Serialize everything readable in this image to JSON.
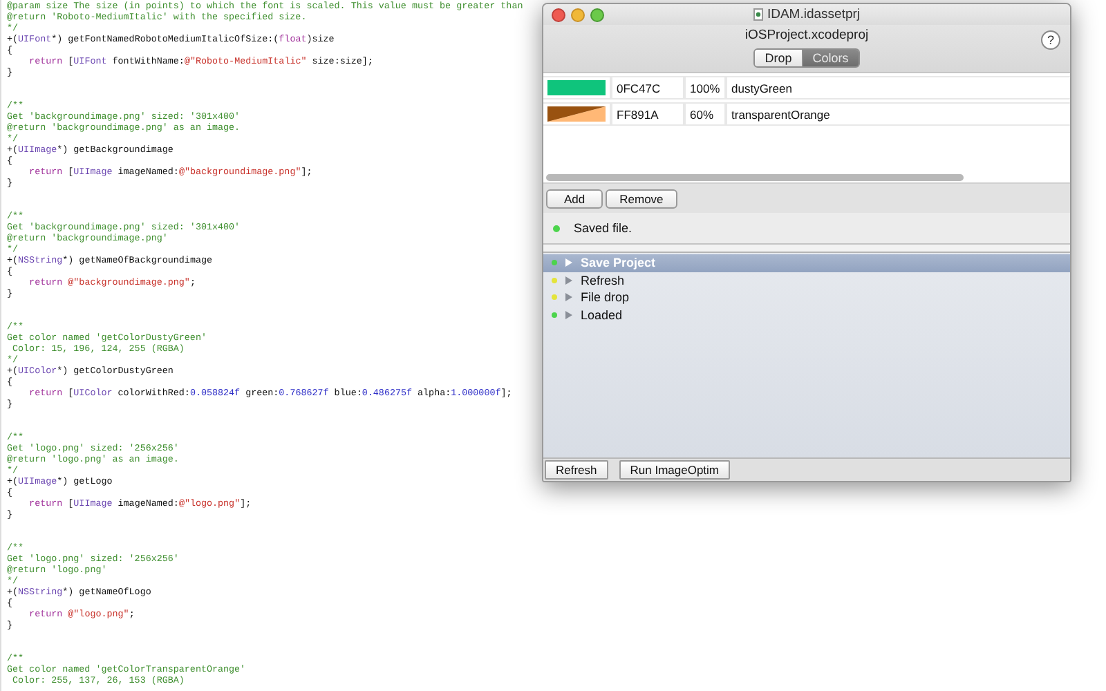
{
  "editor": {
    "blocks": [
      {
        "lines": [
          [
            {
              "kind": "comment",
              "text": "@param size The size (in points) to which the font is scaled. This value must be greater than"
            }
          ],
          [
            {
              "kind": "comment",
              "text": "@return 'Roboto-MediumItalic' with the specified size."
            }
          ],
          [
            {
              "kind": "comment",
              "text": "*/"
            }
          ],
          [
            {
              "kind": "plain",
              "text": "+("
            },
            {
              "kind": "type",
              "text": "UIFont"
            },
            {
              "kind": "plain",
              "text": "*) getFontNamedRobotoMediumItalicOfSize:("
            },
            {
              "kind": "keyword",
              "text": "float"
            },
            {
              "kind": "plain",
              "text": ")size"
            }
          ],
          [
            {
              "kind": "plain",
              "text": "{"
            }
          ],
          [
            {
              "kind": "keyword",
              "text": "    return"
            },
            {
              "kind": "plain",
              "text": " ["
            },
            {
              "kind": "type",
              "text": "UIFont"
            },
            {
              "kind": "plain",
              "text": " fontWithName:"
            },
            {
              "kind": "string",
              "text": "@\"Roboto-MediumItalic\""
            },
            {
              "kind": "plain",
              "text": " size:size];"
            }
          ],
          [
            {
              "kind": "plain",
              "text": "}"
            }
          ]
        ]
      },
      {
        "lines": [
          [
            {
              "kind": "comment",
              "text": "/**"
            }
          ],
          [
            {
              "kind": "comment",
              "text": "Get 'backgroundimage.png' sized: '301x400'"
            }
          ],
          [
            {
              "kind": "comment",
              "text": "@return 'backgroundimage.png' as an image."
            }
          ],
          [
            {
              "kind": "comment",
              "text": "*/"
            }
          ],
          [
            {
              "kind": "plain",
              "text": "+("
            },
            {
              "kind": "type",
              "text": "UIImage"
            },
            {
              "kind": "plain",
              "text": "*) getBackgroundimage"
            }
          ],
          [
            {
              "kind": "plain",
              "text": "{"
            }
          ],
          [
            {
              "kind": "keyword",
              "text": "    return"
            },
            {
              "kind": "plain",
              "text": " ["
            },
            {
              "kind": "type",
              "text": "UIImage"
            },
            {
              "kind": "plain",
              "text": " imageNamed:"
            },
            {
              "kind": "string",
              "text": "@\"backgroundimage.png\""
            },
            {
              "kind": "plain",
              "text": "];"
            }
          ],
          [
            {
              "kind": "plain",
              "text": "}"
            }
          ]
        ]
      },
      {
        "lines": [
          [
            {
              "kind": "comment",
              "text": "/**"
            }
          ],
          [
            {
              "kind": "comment",
              "text": "Get 'backgroundimage.png' sized: '301x400'"
            }
          ],
          [
            {
              "kind": "comment",
              "text": "@return 'backgroundimage.png'"
            }
          ],
          [
            {
              "kind": "comment",
              "text": "*/"
            }
          ],
          [
            {
              "kind": "plain",
              "text": "+("
            },
            {
              "kind": "type",
              "text": "NSString"
            },
            {
              "kind": "plain",
              "text": "*) getNameOfBackgroundimage"
            }
          ],
          [
            {
              "kind": "plain",
              "text": "{"
            }
          ],
          [
            {
              "kind": "keyword",
              "text": "    return"
            },
            {
              "kind": "string",
              "text": " @\"backgroundimage.png\""
            },
            {
              "kind": "plain",
              "text": ";"
            }
          ],
          [
            {
              "kind": "plain",
              "text": "}"
            }
          ]
        ]
      },
      {
        "lines": [
          [
            {
              "kind": "comment",
              "text": "/**"
            }
          ],
          [
            {
              "kind": "comment",
              "text": "Get color named 'getColorDustyGreen'"
            }
          ],
          [
            {
              "kind": "comment",
              "text": " Color: 15, 196, 124, 255 (RGBA)"
            }
          ],
          [
            {
              "kind": "comment",
              "text": "*/"
            }
          ],
          [
            {
              "kind": "plain",
              "text": "+("
            },
            {
              "kind": "type",
              "text": "UIColor"
            },
            {
              "kind": "plain",
              "text": "*) getColorDustyGreen"
            }
          ],
          [
            {
              "kind": "plain",
              "text": "{"
            }
          ],
          [
            {
              "kind": "keyword",
              "text": "    return"
            },
            {
              "kind": "plain",
              "text": " ["
            },
            {
              "kind": "type",
              "text": "UIColor"
            },
            {
              "kind": "plain",
              "text": " colorWithRed:"
            },
            {
              "kind": "number",
              "text": "0.058824f"
            },
            {
              "kind": "plain",
              "text": " green:"
            },
            {
              "kind": "number",
              "text": "0.768627f"
            },
            {
              "kind": "plain",
              "text": " blue:"
            },
            {
              "kind": "number",
              "text": "0.486275f"
            },
            {
              "kind": "plain",
              "text": " alpha:"
            },
            {
              "kind": "number",
              "text": "1.000000f"
            },
            {
              "kind": "plain",
              "text": "];"
            }
          ],
          [
            {
              "kind": "plain",
              "text": "}"
            }
          ]
        ]
      },
      {
        "lines": [
          [
            {
              "kind": "comment",
              "text": "/**"
            }
          ],
          [
            {
              "kind": "comment",
              "text": "Get 'logo.png' sized: '256x256'"
            }
          ],
          [
            {
              "kind": "comment",
              "text": "@return 'logo.png' as an image."
            }
          ],
          [
            {
              "kind": "comment",
              "text": "*/"
            }
          ],
          [
            {
              "kind": "plain",
              "text": "+("
            },
            {
              "kind": "type",
              "text": "UIImage"
            },
            {
              "kind": "plain",
              "text": "*) getLogo"
            }
          ],
          [
            {
              "kind": "plain",
              "text": "{"
            }
          ],
          [
            {
              "kind": "keyword",
              "text": "    return"
            },
            {
              "kind": "plain",
              "text": " ["
            },
            {
              "kind": "type",
              "text": "UIImage"
            },
            {
              "kind": "plain",
              "text": " imageNamed:"
            },
            {
              "kind": "string",
              "text": "@\"logo.png\""
            },
            {
              "kind": "plain",
              "text": "];"
            }
          ],
          [
            {
              "kind": "plain",
              "text": "}"
            }
          ]
        ]
      },
      {
        "lines": [
          [
            {
              "kind": "comment",
              "text": "/**"
            }
          ],
          [
            {
              "kind": "comment",
              "text": "Get 'logo.png' sized: '256x256'"
            }
          ],
          [
            {
              "kind": "comment",
              "text": "@return 'logo.png'"
            }
          ],
          [
            {
              "kind": "comment",
              "text": "*/"
            }
          ],
          [
            {
              "kind": "plain",
              "text": "+("
            },
            {
              "kind": "type",
              "text": "NSString"
            },
            {
              "kind": "plain",
              "text": "*) getNameOfLogo"
            }
          ],
          [
            {
              "kind": "plain",
              "text": "{"
            }
          ],
          [
            {
              "kind": "keyword",
              "text": "    return"
            },
            {
              "kind": "string",
              "text": " @\"logo.png\""
            },
            {
              "kind": "plain",
              "text": ";"
            }
          ],
          [
            {
              "kind": "plain",
              "text": "}"
            }
          ]
        ]
      },
      {
        "lines": [
          [
            {
              "kind": "comment",
              "text": "/**"
            }
          ],
          [
            {
              "kind": "comment",
              "text": "Get color named 'getColorTransparentOrange'"
            }
          ],
          [
            {
              "kind": "comment",
              "text": " Color: 255, 137, 26, 153 (RGBA)"
            }
          ]
        ]
      }
    ]
  },
  "window": {
    "title": "IDAM.idassetprj",
    "project": "iOSProject.xcodeproj",
    "help": "?",
    "tabs": [
      {
        "label": "Drop",
        "selected": false
      },
      {
        "label": "Colors",
        "selected": true
      }
    ],
    "colors": [
      {
        "hex": "0FC47C",
        "opacity": "100%",
        "name": "dustyGreen"
      },
      {
        "hex": "FF891A",
        "opacity": "60%",
        "name": "transparentOrange"
      }
    ],
    "color_buttons": [
      "Add",
      "Remove"
    ],
    "status": {
      "text": "Saved file.",
      "color": "#4cd44c"
    },
    "log": [
      {
        "label": "Save Project",
        "color": "#4cd44c",
        "selected": true
      },
      {
        "label": "Refresh",
        "color": "#e4e43c",
        "selected": false
      },
      {
        "label": "File drop",
        "color": "#e4e43c",
        "selected": false
      },
      {
        "label": "Loaded",
        "color": "#4cd44c",
        "selected": false
      }
    ],
    "bottom_buttons": [
      "Refresh",
      "Run ImageOptim"
    ]
  }
}
